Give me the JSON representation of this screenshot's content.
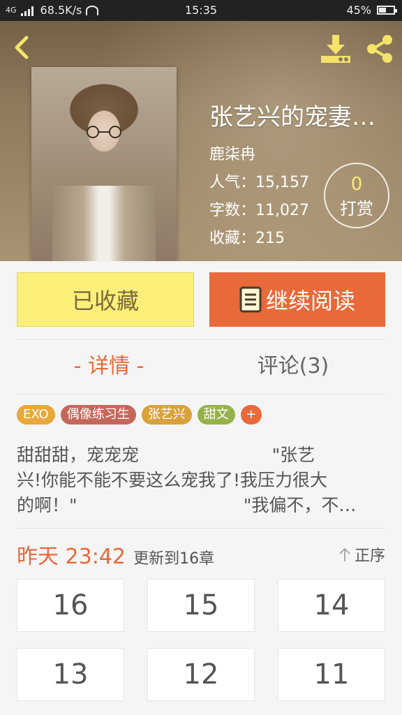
{
  "status_bar": {
    "network": "4G",
    "speed": "68.5K/s",
    "time": "15:35",
    "battery": "45%"
  },
  "header": {
    "back_icon": "chevron-left-icon",
    "download_icon": "download-icon",
    "share_icon": "share-icon"
  },
  "book": {
    "title": "张艺兴的宠妻…",
    "author": "鹿柒冉",
    "popularity_label": "人气：",
    "popularity": "15,157",
    "words_label": "字数：",
    "words": "11,027",
    "favorites_label": "收藏：",
    "favorites": "215"
  },
  "reward": {
    "count": "0",
    "label": "打赏"
  },
  "actions": {
    "favorite_label": "已收藏",
    "read_label": "继续阅读",
    "read_icon": "book-icon"
  },
  "tabs": {
    "detail": "- 详情 -",
    "comments": "评论(3)"
  },
  "tags": [
    {
      "label": "EXO",
      "color": "#e9a83a"
    },
    {
      "label": "偶像练习生",
      "color": "#c4695a"
    },
    {
      "label": "张艺兴",
      "color": "#d9a13c"
    },
    {
      "label": "甜文",
      "color": "#97b24d"
    },
    {
      "label": "+",
      "color": "#e8693a"
    }
  ],
  "description": {
    "line1": "甜甜甜，宠宠宠                        \"张艺",
    "line2": "兴!你能不能不要这么宠我了!我压力很大",
    "line3": "的啊！\"                              \"我偏不，不…"
  },
  "update": {
    "time": "昨天 23:42",
    "label": "更新到16章",
    "sort_label": "正序"
  },
  "chapters": [
    "16",
    "15",
    "14",
    "13",
    "12",
    "11"
  ],
  "colors": {
    "accent": "#e8693a",
    "favorite_bg": "#fbef7a"
  }
}
